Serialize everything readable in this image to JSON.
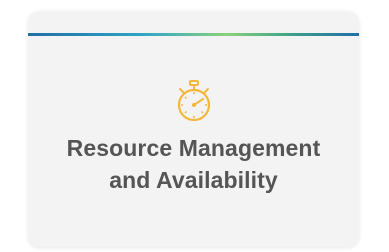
{
  "card": {
    "icon": "stopwatch-icon",
    "title_lines": [
      "Resource Management",
      "and Availability"
    ],
    "colors": {
      "icon": "#f2b73b",
      "title": "#555555",
      "accent_start": "#1f6ea8",
      "accent_mid": "#8bd17a",
      "accent_end": "#1f6ea8",
      "card_background": "#f3f3f3"
    }
  }
}
